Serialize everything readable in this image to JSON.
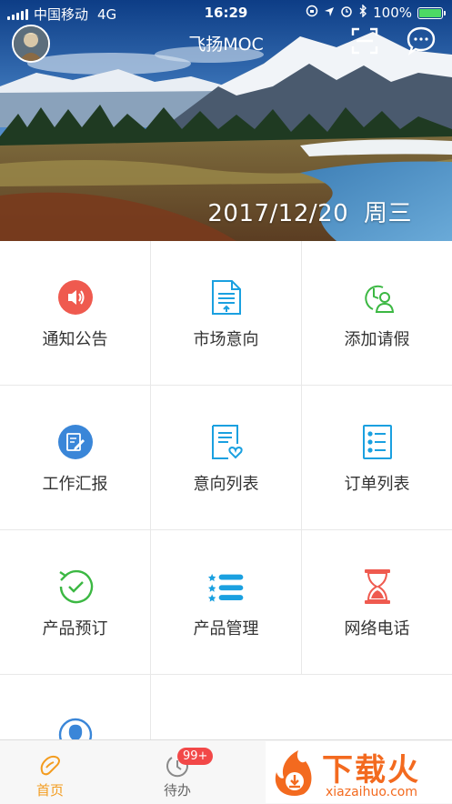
{
  "status_bar": {
    "carrier": "中国移动",
    "network": "4G",
    "time": "16:29",
    "battery": "100%"
  },
  "header": {
    "title": "飞扬MOC",
    "date": "2017/12/20",
    "weekday": "周三"
  },
  "menu": {
    "items": [
      {
        "label": "通知公告",
        "icon": "speaker-icon",
        "color": "#ef5a4f"
      },
      {
        "label": "市场意向",
        "icon": "document-icon",
        "color": "#1aa0e0"
      },
      {
        "label": "添加请假",
        "icon": "clock-person-icon",
        "color": "#3cb843"
      },
      {
        "label": "工作汇报",
        "icon": "edit-report-icon",
        "color": "#3a86d8"
      },
      {
        "label": "意向列表",
        "icon": "heart-list-icon",
        "color": "#1aa0e0"
      },
      {
        "label": "订单列表",
        "icon": "order-list-icon",
        "color": "#1aa0e0"
      },
      {
        "label": "产品预订",
        "icon": "refresh-check-icon",
        "color": "#3cb843"
      },
      {
        "label": "产品管理",
        "icon": "star-list-icon",
        "color": "#1aa0e0"
      },
      {
        "label": "网络电话",
        "icon": "hourglass-icon",
        "color": "#ef5a4f"
      },
      {
        "label": "",
        "icon": "user-icon",
        "color": "#3a86d8"
      }
    ]
  },
  "tabbar": {
    "home_label": "首页",
    "todo_label": "待办",
    "todo_badge": "99+",
    "active_color": "#f39c1f"
  },
  "watermark": {
    "main": "下载火",
    "sub": "xiazaihuo.com"
  }
}
